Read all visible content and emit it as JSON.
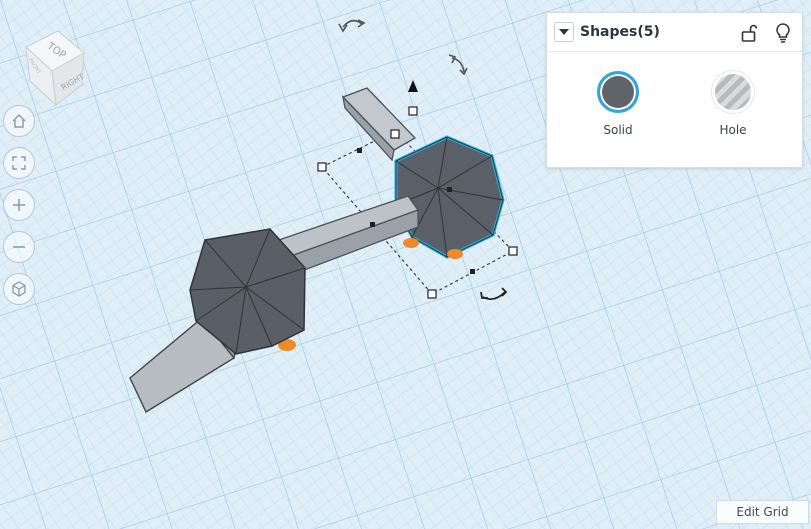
{
  "viewcube": {
    "top": "TOP",
    "front": "FRONT",
    "right": "RIGHT"
  },
  "nav": [
    {
      "name": "home-view",
      "icon": "home-icon"
    },
    {
      "name": "fit-view",
      "icon": "fit-icon"
    },
    {
      "name": "zoom-in",
      "icon": "plus-icon"
    },
    {
      "name": "zoom-out",
      "icon": "minus-icon"
    },
    {
      "name": "perspective",
      "icon": "cube-icon"
    }
  ],
  "panel": {
    "title": "Shapes(5)",
    "solid_label": "Solid",
    "hole_label": "Hole"
  },
  "edit_grid_label": "Edit Grid",
  "colors": {
    "grid_bg": "#dfeef7",
    "grid_line": "#a9d3ea",
    "shape_dark": "#5a6068",
    "shape_light": "#a9b0b7",
    "selection": "#1fb6ea",
    "accent_orange": "#f08a24"
  }
}
